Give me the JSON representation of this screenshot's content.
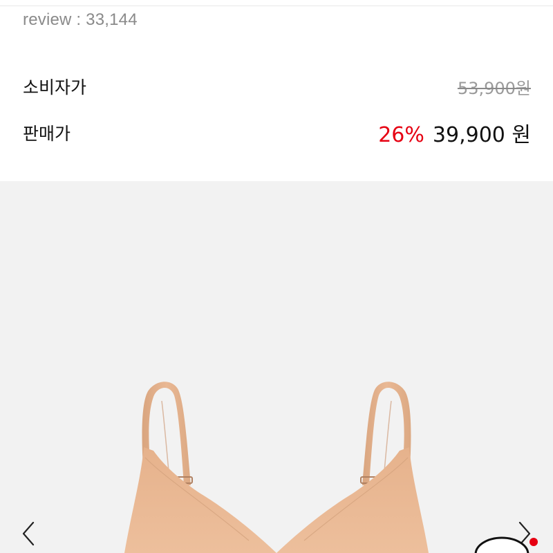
{
  "product": {
    "review_text": "review : 33,144"
  },
  "pricing": {
    "list_label": "소비자가",
    "list_price": "53,900원",
    "sale_label": "판매가",
    "discount": "26%",
    "sale_price": "39,900 원"
  },
  "colors": {
    "discount": "#e60012",
    "image_bg": "#f2f2f2",
    "product": "#e9b894",
    "badge": "#e60012"
  },
  "icons": {
    "prev": "chevron-left-icon",
    "next": "chevron-right-icon",
    "chat": "chat-bubble-icon"
  }
}
